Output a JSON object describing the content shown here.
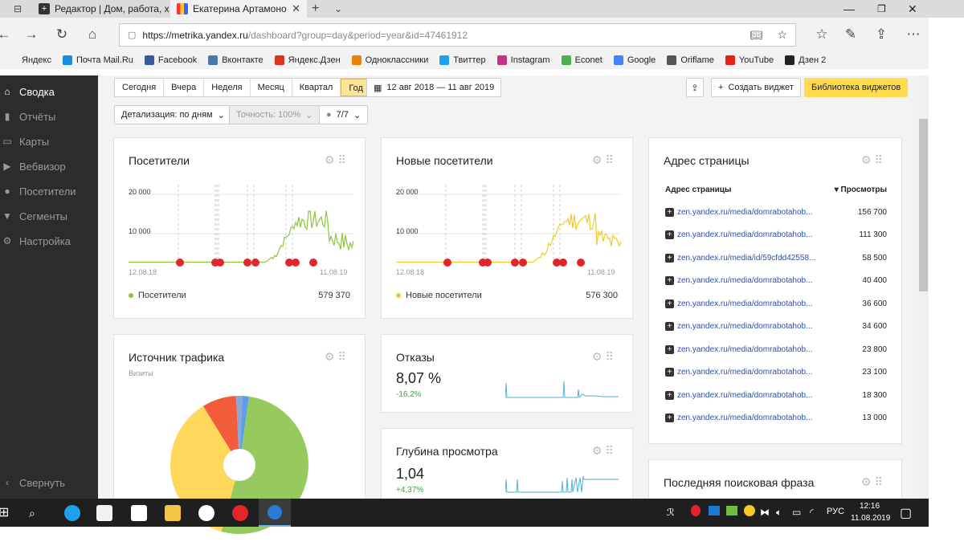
{
  "tabs": [
    {
      "label": "Редактор | Дом, работа, хо"
    },
    {
      "label": "Екатерина Артамонова"
    }
  ],
  "browser": {
    "url_domain": "https://metrika.yandex.ru",
    "url_path": "/dashboard?group=day&period=year&id=47461912"
  },
  "bookmarks": [
    {
      "label": "Яндекс",
      "color": "#f2f2f2"
    },
    {
      "label": "Почта Mail.Ru",
      "color": "#168de2"
    },
    {
      "label": "Facebook",
      "color": "#3b5998"
    },
    {
      "label": "Вконтакте",
      "color": "#4a76a8"
    },
    {
      "label": "Яндекс.Дзен",
      "color": "#e0301e"
    },
    {
      "label": "Одноклассники",
      "color": "#ee8208"
    },
    {
      "label": "Твиттер",
      "color": "#1da1f2"
    },
    {
      "label": "Instagram",
      "color": "#c13584"
    },
    {
      "label": "Econet",
      "color": "#4caf50"
    },
    {
      "label": "Google",
      "color": "#4285f4"
    },
    {
      "label": "Oriflame",
      "color": "#555555"
    },
    {
      "label": "YouTube",
      "color": "#e62117"
    },
    {
      "label": "Дзен 2",
      "color": "#222222"
    }
  ],
  "sidebar": {
    "items": [
      {
        "label": "Сводка",
        "icon": "home-icon",
        "active": true
      },
      {
        "label": "Отчёты",
        "icon": "bar-chart-icon"
      },
      {
        "label": "Карты",
        "icon": "map-icon"
      },
      {
        "label": "Вебвизор",
        "icon": "play-icon"
      },
      {
        "label": "Посетители",
        "icon": "user-icon"
      },
      {
        "label": "Сегменты",
        "icon": "filter-icon"
      },
      {
        "label": "Настройка",
        "icon": "gear-icon"
      }
    ],
    "collapse_label": "Свернуть"
  },
  "toolbar": {
    "periods": [
      "Сегодня",
      "Вчера",
      "Неделя",
      "Месяц",
      "Квартал",
      "Год"
    ],
    "active_period": "Год",
    "date_range": "12 авг 2018 — 11 авг 2019",
    "detail": "Детализация: по дням",
    "accuracy": "Точность: 100%",
    "counter": "7/7",
    "create_widget": "Создать виджет",
    "library": "Библиотека виджетов"
  },
  "widgets": {
    "visitors": {
      "title": "Посетители",
      "y_top": "20 000",
      "y_mid": "10 000",
      "x_start": "12.08.18",
      "x_end": "11.08.19",
      "legend": "Посетители",
      "total": "579 370",
      "color": "#8cc63f"
    },
    "new_visitors": {
      "title": "Новые посетители",
      "y_top": "20 000",
      "y_mid": "10 000",
      "x_start": "12.08.18",
      "x_end": "11.08.19",
      "legend": "Новые посетители",
      "total": "576 300",
      "color": "#f5c92a"
    },
    "pages": {
      "title": "Адрес страницы",
      "col1": "Адрес страницы",
      "col2": "▾ Просмотры",
      "rows": [
        {
          "url": "zen.yandex.ru/media/domrabotahob...",
          "views": "156 700"
        },
        {
          "url": "zen.yandex.ru/media/domrabotahob...",
          "views": "111 300"
        },
        {
          "url": "zen.yandex.ru/media/id/59cfdd42558...",
          "views": "58 500"
        },
        {
          "url": "zen.yandex.ru/media/domrabotahob...",
          "views": "40 400"
        },
        {
          "url": "zen.yandex.ru/media/domrabotahob...",
          "views": "36 600"
        },
        {
          "url": "zen.yandex.ru/media/domrabotahob...",
          "views": "34 600"
        },
        {
          "url": "zen.yandex.ru/media/domrabotahob...",
          "views": "23 800"
        },
        {
          "url": "zen.yandex.ru/media/domrabotahob...",
          "views": "23 100"
        },
        {
          "url": "zen.yandex.ru/media/domrabotahob...",
          "views": "18 300"
        },
        {
          "url": "zen.yandex.ru/media/domrabotahob...",
          "views": "13 000"
        }
      ]
    },
    "traffic": {
      "title": "Источник трафика",
      "subtitle": "Визиты"
    },
    "bounce": {
      "title": "Отказы",
      "value": "8,07 %",
      "delta": "-16,2%"
    },
    "depth": {
      "title": "Глубина просмотра",
      "value": "1,04",
      "delta": "+4,37%"
    },
    "search": {
      "title": "Последняя поисковая фраза"
    }
  },
  "taskbar": {
    "lang": "РУС",
    "time": "12:16",
    "date": "11.08.2019"
  },
  "chart_data": [
    {
      "type": "line",
      "title": "Посетители",
      "x": [
        "12.08.18",
        "11.08.19"
      ],
      "ylim": [
        0,
        20000
      ],
      "series": [
        {
          "name": "Посетители",
          "total": 579370
        }
      ]
    },
    {
      "type": "line",
      "title": "Новые посетители",
      "x": [
        "12.08.18",
        "11.08.19"
      ],
      "ylim": [
        0,
        20000
      ],
      "series": [
        {
          "name": "Новые посетители",
          "total": 576300
        }
      ]
    },
    {
      "type": "pie",
      "title": "Источник трафика",
      "subtitle": "Визиты",
      "series": [
        {
          "values": [
            52,
            37,
            8,
            1.5,
            1.5
          ],
          "colors": [
            "#97ca5e",
            "#ffd75b",
            "#f25c3a",
            "#8aa7d6",
            "#5aa0e6"
          ]
        }
      ]
    }
  ]
}
